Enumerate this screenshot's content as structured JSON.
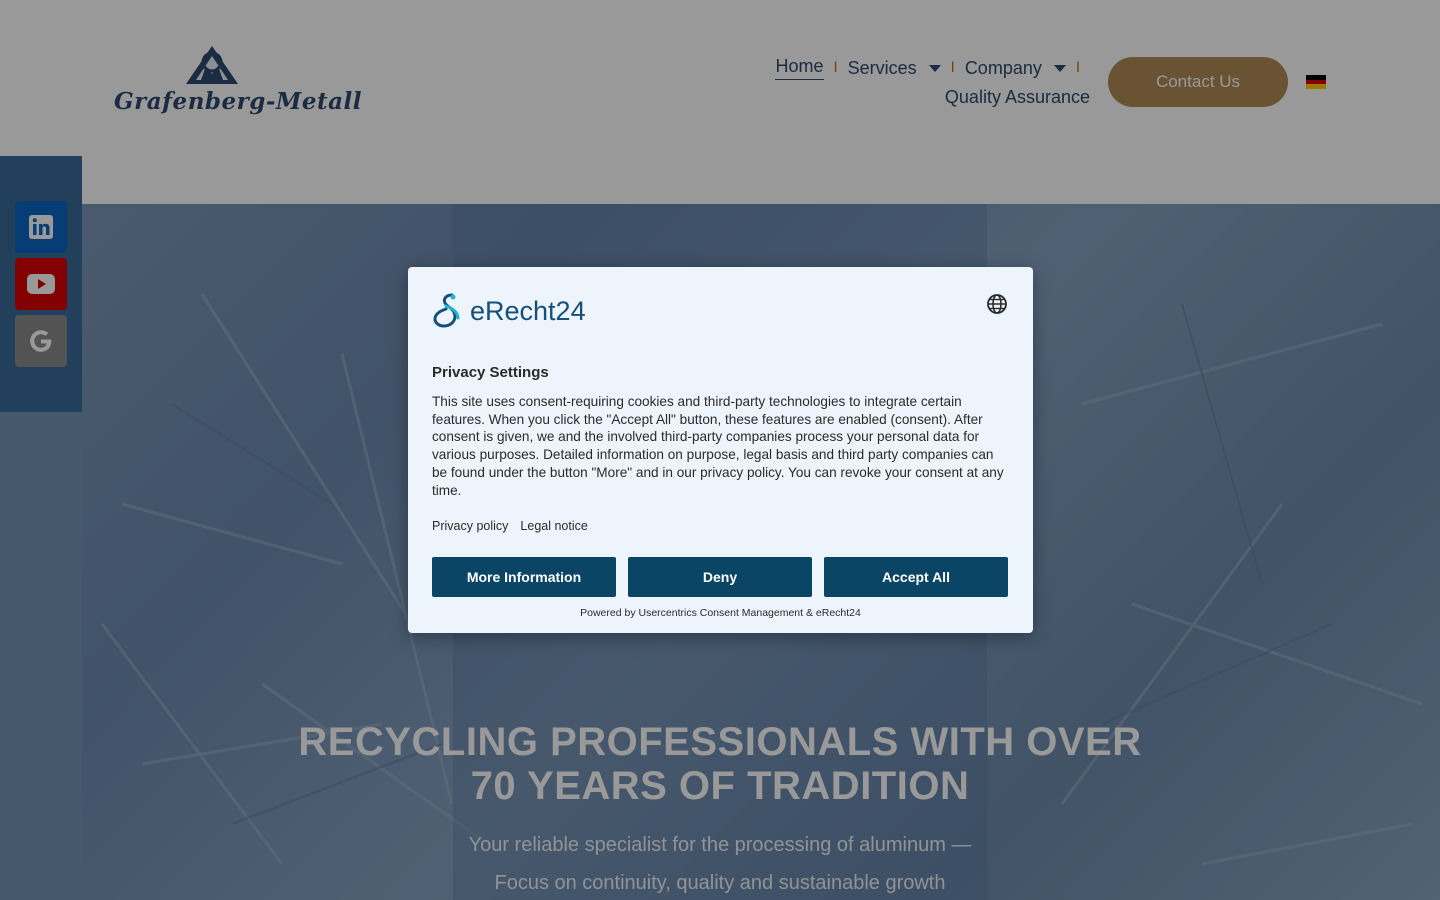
{
  "header": {
    "logo_text": "Grafenberg-Metall",
    "nav": {
      "home": "Home",
      "services": "Services",
      "company": "Company",
      "quality": "Quality Assurance",
      "separator": "I"
    },
    "contact_label": "Contact Us"
  },
  "social": {
    "items": [
      {
        "name": "linkedin",
        "color": "#0a66c2"
      },
      {
        "name": "youtube",
        "color": "#d90000"
      },
      {
        "name": "google",
        "color": "#8a8a8a"
      }
    ]
  },
  "hero": {
    "title_line1": "RECYCLING PROFESSIONALS WITH OVER",
    "title_line2": "70 YEARS OF TRADITION",
    "subtitle_line1": "Your reliable specialist for the processing of aluminum —",
    "subtitle_line2": "Focus on continuity, quality and sustainable growth"
  },
  "consent": {
    "brand": "eRecht24",
    "title": "Privacy Settings",
    "body": "This site uses consent-requiring cookies and third-party technologies to integrate certain features. When you click the \"Accept All\" button, these features are enabled (consent). After consent is given, we and the involved third-party companies process your personal data for various purposes. Detailed information on purpose, legal basis and third party companies can be found under the button \"More\" and in our privacy policy. You can revoke your consent at any time.",
    "links": {
      "privacy": "Privacy policy",
      "legal": "Legal notice"
    },
    "buttons": {
      "more": "More Information",
      "deny": "Deny",
      "accept": "Accept All"
    },
    "powered_by": "Powered by Usercentrics Consent Management & eRecht24"
  },
  "colors": {
    "accent": "#b08a55",
    "navy": "#2d4a6e",
    "consent_button": "#0b4566"
  }
}
